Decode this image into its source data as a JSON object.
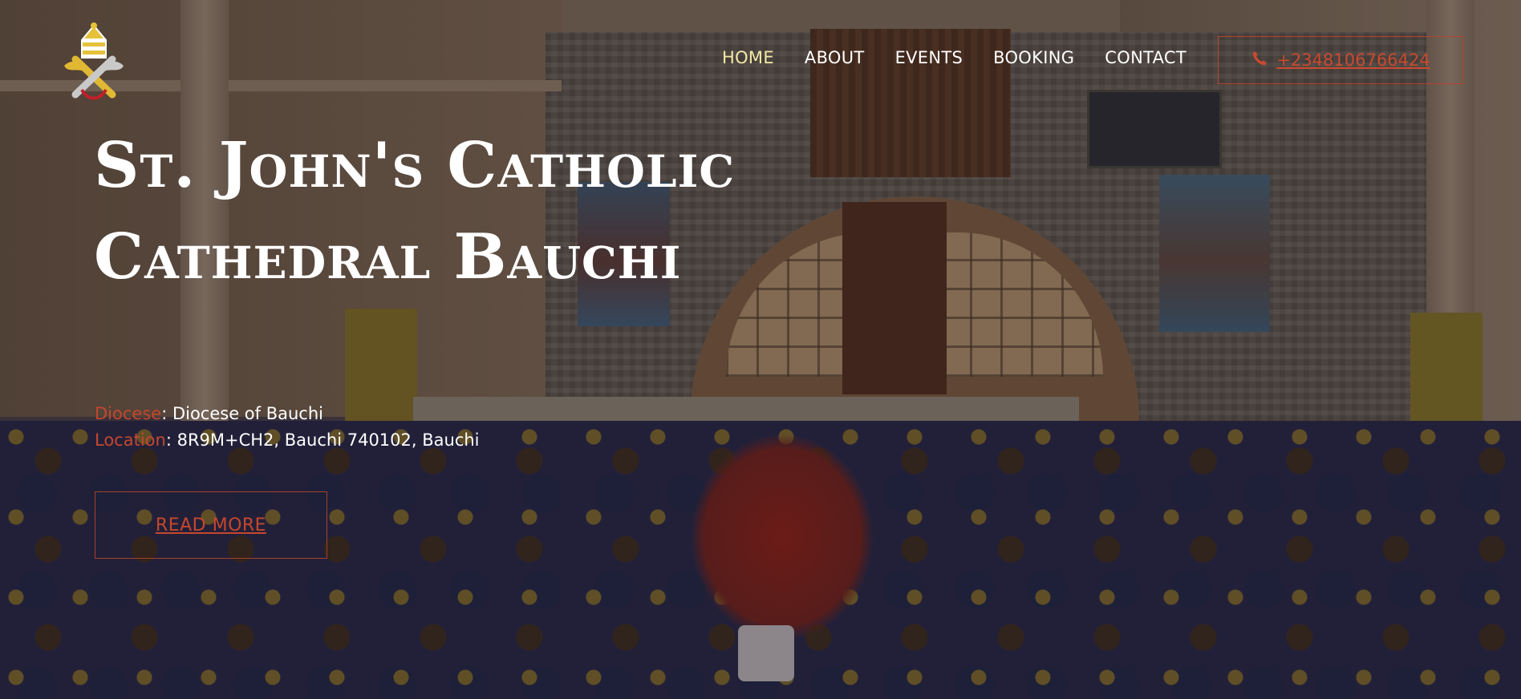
{
  "brand": {
    "logo_icon": "papal-coat-of-arms-icon"
  },
  "nav": {
    "items": [
      {
        "label": "HOME",
        "active": true
      },
      {
        "label": "ABOUT",
        "active": false
      },
      {
        "label": "EVENTS",
        "active": false
      },
      {
        "label": "BOOKING",
        "active": false
      },
      {
        "label": "CONTACT",
        "active": false
      }
    ],
    "phone": {
      "icon": "phone-icon",
      "label": "+2348106766424"
    }
  },
  "hero": {
    "title": "St. John's Catholic Cathedral Bauchi",
    "diocese_key": "Diocese",
    "diocese_value": ": Diocese of Bauchi",
    "location_key": "Location",
    "location_value": ": 8R9M+CH2, Bauchi 740102, Bauchi",
    "read_more": "READ MORE"
  },
  "colors": {
    "accent": "#c4472e",
    "nav_active": "#f2e9a6",
    "text": "#ffffff"
  }
}
